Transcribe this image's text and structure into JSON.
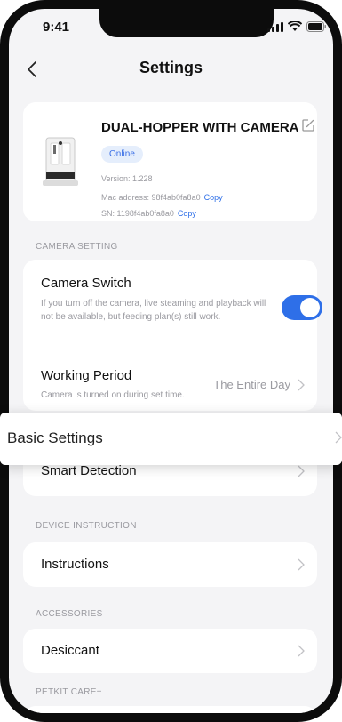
{
  "status_bar": {
    "time": "9:41"
  },
  "nav": {
    "title": "Settings"
  },
  "device": {
    "name": "DUAL-HOPPER WITH CAMERA",
    "status": "Online",
    "version": "Version: 1.228",
    "mac_address": "Mac address: 98f4ab0fa8a0",
    "mac_copy": "Copy",
    "sn": "SN:  1198f4ab0fa8a0",
    "sn_copy": "Copy"
  },
  "camera_setting": {
    "section_label": "CAMERA SETTING",
    "camera_switch": {
      "title": "Camera Switch",
      "description": "If you turn off the camera, live steaming and playback will not be available, but feeding plan(s) still work.",
      "enabled": true
    },
    "working_period": {
      "title": "Working Period",
      "description": "Camera is turned on during set time.",
      "value": "The Entire Day"
    }
  },
  "basic_settings": {
    "title": "Basic Settings"
  },
  "smart_detection": {
    "title": "Smart Detection"
  },
  "device_instruction": {
    "section_label": "DEVICE INSTRUCTION",
    "instructions": "Instructions"
  },
  "accessories": {
    "section_label": "ACCESSORIES",
    "desiccant": "Desiccant"
  },
  "petkit_care": {
    "section_label": "PETKIT CARE+"
  },
  "colors": {
    "accent": "#2e6fe8",
    "background": "#f4f4f6",
    "online_badge_bg": "#e5eefc"
  }
}
